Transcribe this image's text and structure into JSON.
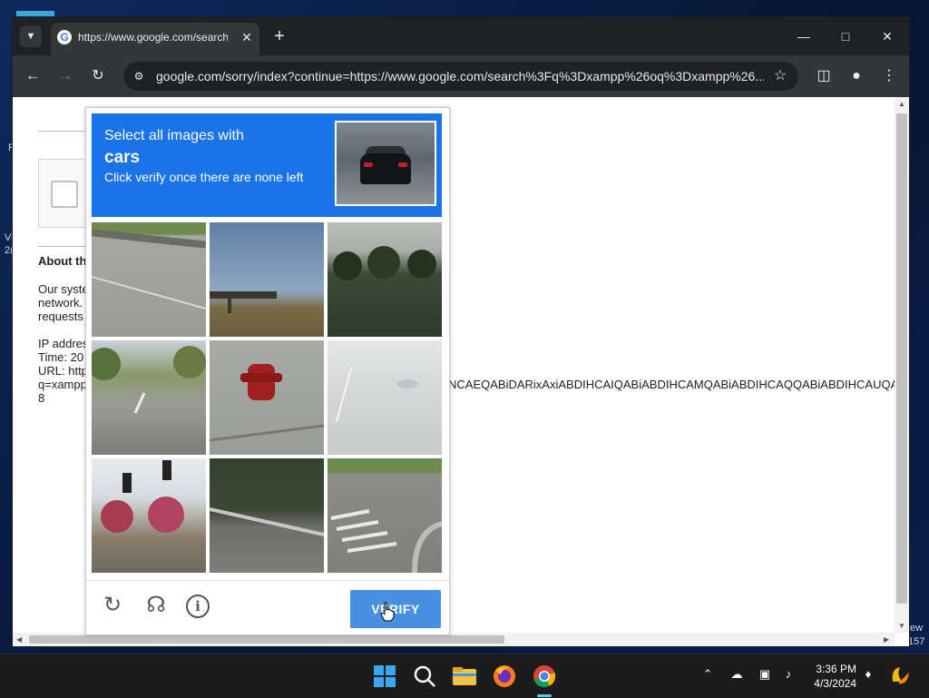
{
  "browser": {
    "tab_title": "https://www.google.com/search?q=xampp",
    "url": "google.com/sorry/index?continue=https://www.google.com/search%3Fq%3Dxampp%26oq%3Dxampp%26..."
  },
  "page": {
    "about_heading": "About th",
    "line1": "Our syste",
    "line2": "network.",
    "line3": "requests",
    "ip": "IP addres",
    "time": "Time: 20",
    "url_label": "URL: http",
    "q": "q=xampp",
    "n8": "8",
    "long_line": "NCAEQABiDARixAxiABDIHCAIQABiABDIHCAMQABiABDIHCAQQABiABDIHCAUQA"
  },
  "captcha": {
    "instruction_line1": "Select all images with",
    "target": "cars",
    "instruction_line3": "Click verify once there are none left",
    "verify_label": "VERIFY",
    "tiles": [
      "guardrail-road",
      "overpass-field",
      "palm-trees",
      "street-trees",
      "fire-hydrant",
      "faded-road",
      "traffic-light-trees",
      "guardrail-grass",
      "crosswalk"
    ]
  },
  "desktop": {
    "left_text1": "F",
    "left_text2": "Vi",
    "left_text3": "2(",
    "right_text1": "ew",
    "right_text2": "157"
  },
  "taskbar": {
    "time": "3:36 PM",
    "date": "4/3/2024"
  }
}
